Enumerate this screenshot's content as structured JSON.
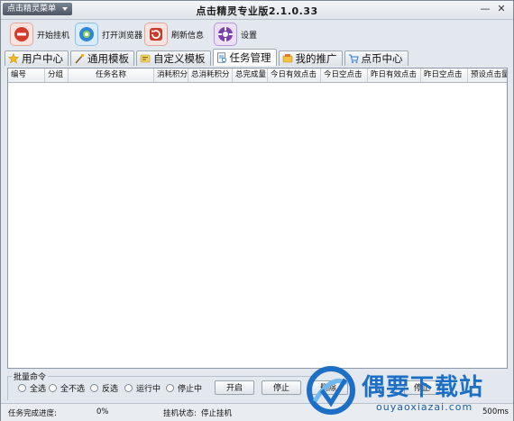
{
  "window": {
    "app_menu_label": "点击精灵菜单",
    "title": "点击精灵专业版2.1.0.33",
    "minimize_glyph": "—",
    "close_glyph": "✕"
  },
  "toolbar": {
    "buttons": [
      {
        "label": "开始挂机",
        "icon": "start-hang-icon",
        "color": "#c0392b"
      },
      {
        "label": "打开浏览器",
        "icon": "browser-icon",
        "color": "#2a7fd4"
      },
      {
        "label": "刷新信息",
        "icon": "refresh-icon",
        "color": "#c0392b"
      },
      {
        "label": "设置",
        "icon": "settings-icon",
        "color": "#7b3fb0"
      }
    ]
  },
  "tabs": [
    {
      "label": "用户中心",
      "icon": "star-icon",
      "active": false
    },
    {
      "label": "通用模板",
      "icon": "wand-icon",
      "active": false
    },
    {
      "label": "自定义模板",
      "icon": "custom-template-icon",
      "active": false
    },
    {
      "label": "任务管理",
      "icon": "task-icon",
      "active": true
    },
    {
      "label": "我的推广",
      "icon": "promotion-icon",
      "active": false
    },
    {
      "label": "点币中心",
      "icon": "cart-icon",
      "active": false
    }
  ],
  "table": {
    "columns": [
      "编号",
      "分组",
      "任务名称",
      "消耗积分",
      "总消耗积分",
      "总完成量",
      "今日有效点击",
      "今日空点击",
      "昨日有效点击",
      "昨日空点击",
      "预设点击量"
    ],
    "rows": []
  },
  "batch": {
    "legend": "批量命令",
    "radios": [
      "全选",
      "全不选",
      "反选",
      "运行中",
      "停止中"
    ],
    "buttons": [
      "开启",
      "停止",
      "删除"
    ],
    "partial_label": "停止"
  },
  "status": {
    "progress_label": "任务完成进度:",
    "progress_value": "0%",
    "hang_status_label": "挂机状态:",
    "hang_status_value": "停止挂机",
    "right_text": "500ms"
  },
  "watermark": {
    "brand": "偶要下载站",
    "url": "ouyaoxiazai.com",
    "brand_color": "#1c6fc4"
  }
}
